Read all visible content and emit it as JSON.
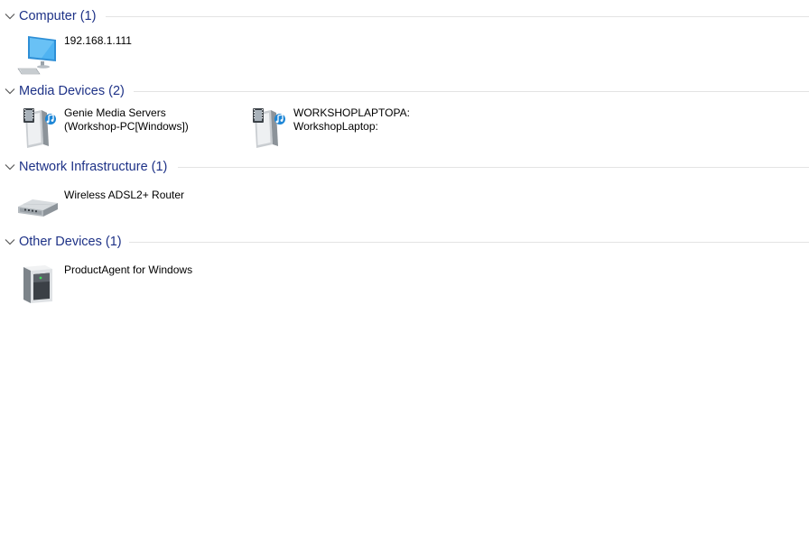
{
  "groups": [
    {
      "title": "Computer (1)",
      "items": [
        {
          "lines": [
            "192.168.1.111"
          ],
          "icon": "computer-icon"
        }
      ]
    },
    {
      "title": "Media Devices (2)",
      "items": [
        {
          "lines": [
            "Genie Media Servers",
            "(Workshop-PC[Windows])"
          ],
          "icon": "media-device-icon"
        },
        {
          "lines": [
            "WORKSHOPLAPTOPA:",
            "WorkshopLaptop:"
          ],
          "icon": "media-device-icon"
        }
      ]
    },
    {
      "title": "Network Infrastructure (1)",
      "items": [
        {
          "lines": [
            "Wireless ADSL2+ Router"
          ],
          "icon": "router-icon"
        }
      ]
    },
    {
      "title": "Other Devices (1)",
      "items": [
        {
          "lines": [
            "ProductAgent for Windows"
          ],
          "icon": "generic-device-icon"
        }
      ]
    }
  ],
  "colors": {
    "group_title": "#1e3287",
    "separator": "#e3e3e3",
    "chevron": "#5a5a5a"
  }
}
